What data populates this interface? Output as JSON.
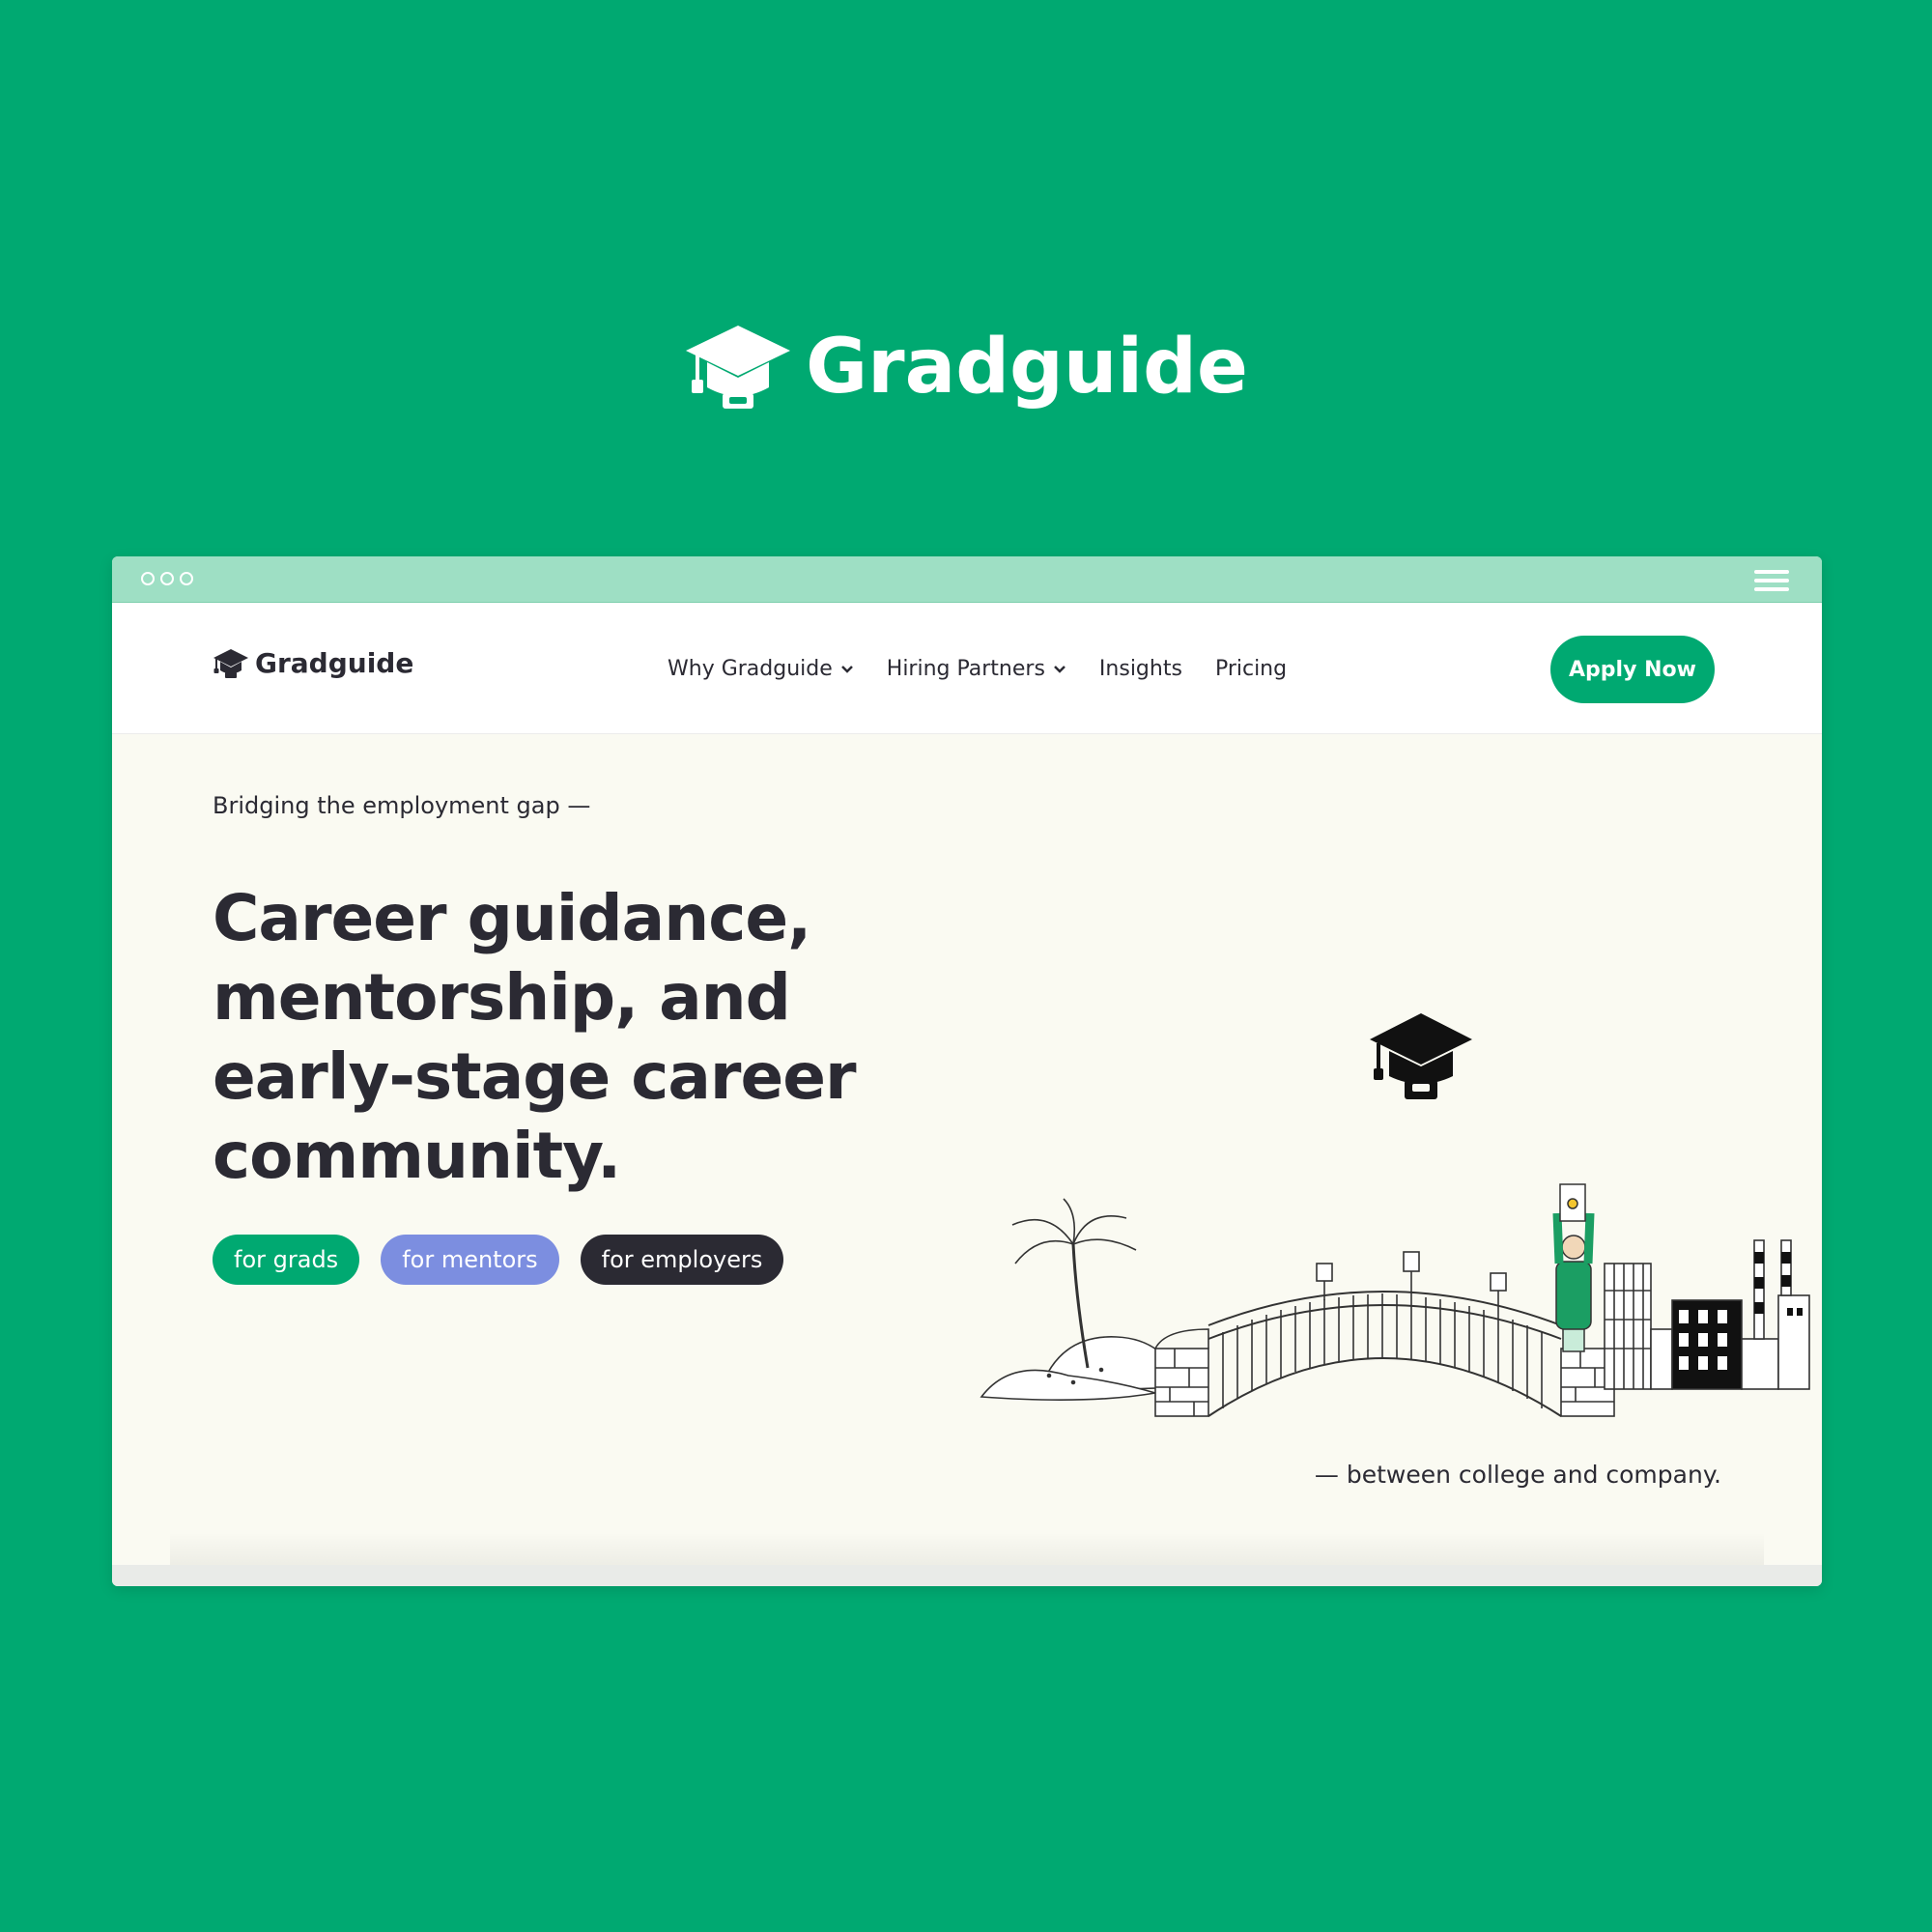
{
  "brand": {
    "name": "Gradguide",
    "logo_icon": "graduation-cap-icon"
  },
  "browser": {
    "window_controls_icon": "window-dots-icon",
    "menu_icon": "hamburger-menu-icon"
  },
  "nav": {
    "logo_text": "Gradguide",
    "links": [
      {
        "label": "Why Gradguide",
        "has_dropdown": true
      },
      {
        "label": "Hiring Partners",
        "has_dropdown": true
      },
      {
        "label": "Insights",
        "has_dropdown": false
      },
      {
        "label": "Pricing",
        "has_dropdown": false
      }
    ],
    "cta_label": "Apply Now"
  },
  "hero": {
    "eyebrow": "Bridging the employment gap —",
    "headline_lines": [
      "Career guidance,",
      "mentorship, and",
      "early-stage career",
      "community."
    ],
    "pills": [
      {
        "label": "for grads",
        "color": "#00a971"
      },
      {
        "label": "for mentors",
        "color": "#7c8ee0"
      },
      {
        "label": "for employers",
        "color": "#2b2a33"
      }
    ],
    "tagline": "— between college and company."
  },
  "colors": {
    "brand_green": "#00a971",
    "chrome_green": "#9edfc4",
    "hero_background": "#fafaf2",
    "text_dark": "#2b2a33",
    "mentor_blue": "#7c8ee0"
  }
}
